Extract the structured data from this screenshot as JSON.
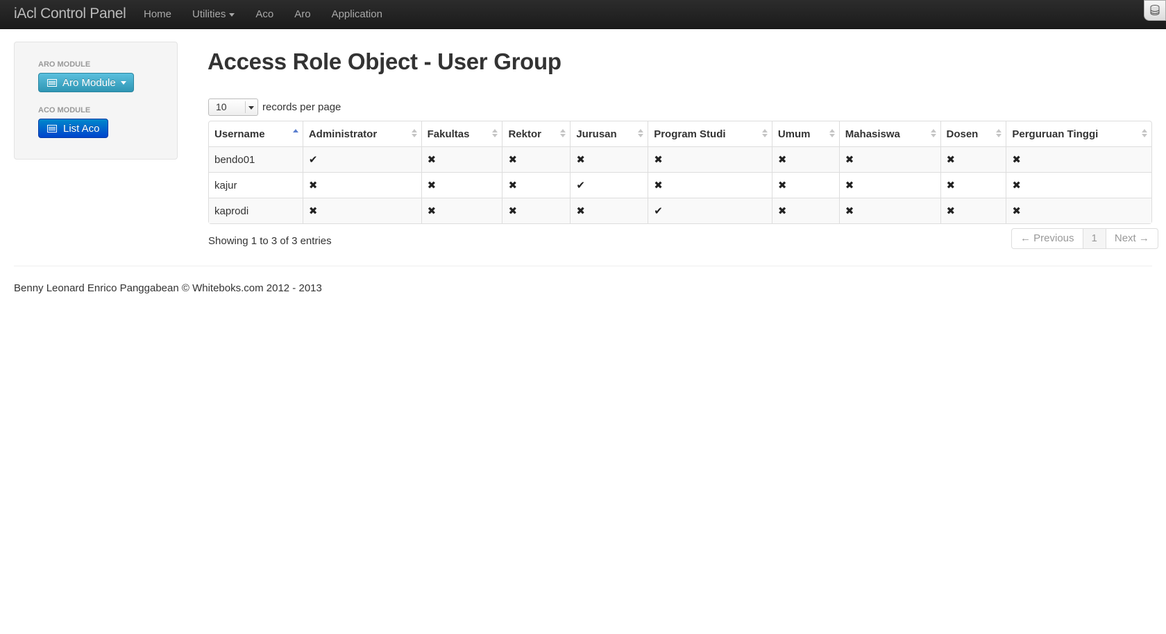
{
  "navbar": {
    "brand": "iAcl Control Panel",
    "items": [
      {
        "label": "Home"
      },
      {
        "label": "Utilities",
        "dropdown": true
      },
      {
        "label": "Aco"
      },
      {
        "label": "Aro"
      },
      {
        "label": "Application"
      }
    ]
  },
  "sidebar": {
    "aro_header": "ARO MODULE",
    "aro_button": "Aro Module",
    "aco_header": "ACO MODULE",
    "aco_button": "List Aco"
  },
  "main": {
    "title": "Access Role Object - User Group",
    "length_value": "10",
    "length_label": "records per page",
    "columns": [
      "Username",
      "Administrator",
      "Fakultas",
      "Rektor",
      "Jurusan",
      "Program Studi",
      "Umum",
      "Mahasiswa",
      "Dosen",
      "Perguruan Tinggi"
    ],
    "rows": [
      {
        "username": "bendo01",
        "cells": [
          "✔",
          "✖",
          "✖",
          "✖",
          "✖",
          "✖",
          "✖",
          "✖",
          "✖"
        ]
      },
      {
        "username": "kajur",
        "cells": [
          "✖",
          "✖",
          "✖",
          "✔",
          "✖",
          "✖",
          "✖",
          "✖",
          "✖"
        ]
      },
      {
        "username": "kaprodi",
        "cells": [
          "✖",
          "✖",
          "✖",
          "✖",
          "✔",
          "✖",
          "✖",
          "✖",
          "✖"
        ]
      }
    ],
    "info": "Showing 1 to 3 of 3 entries",
    "pager": {
      "previous": "← Previous",
      "current": "1",
      "next": "Next →"
    }
  },
  "footer": "Benny Leonard Enrico Panggabean © Whiteboks.com 2012 - 2013",
  "colors": {
    "navbar": "#1b1b1b",
    "info_button": "#2f96b4",
    "primary_button": "#0044cc"
  }
}
